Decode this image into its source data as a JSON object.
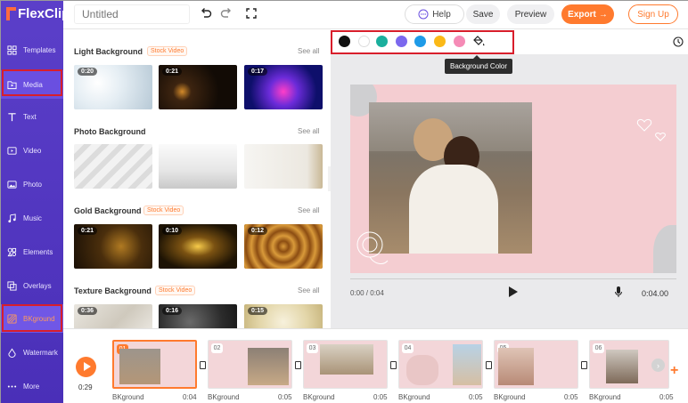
{
  "app": {
    "logo": "FlexClip"
  },
  "sidebar": {
    "items": [
      {
        "label": "Templates",
        "icon": "grid-icon"
      },
      {
        "label": "Media",
        "icon": "folder-play-icon"
      },
      {
        "label": "Text",
        "icon": "text-icon"
      },
      {
        "label": "Video",
        "icon": "video-icon"
      },
      {
        "label": "Photo",
        "icon": "image-icon"
      },
      {
        "label": "Music",
        "icon": "music-icon"
      },
      {
        "label": "Elements",
        "icon": "shapes-icon"
      },
      {
        "label": "Overlays",
        "icon": "layers-icon"
      },
      {
        "label": "BKground",
        "icon": "background-icon"
      },
      {
        "label": "Watermark",
        "icon": "watermark-icon"
      },
      {
        "label": "More",
        "icon": "more-icon"
      }
    ]
  },
  "topbar": {
    "title_placeholder": "Untitled",
    "help_label": "Help",
    "save_label": "Save",
    "preview_label": "Preview",
    "export_label": "Export",
    "signup_label": "Sign Up"
  },
  "panel": {
    "sections": [
      {
        "title": "Light Background",
        "badge": "Stock Video",
        "see_all": "See all",
        "durations": [
          "0:20",
          "0:21",
          "0:17"
        ]
      },
      {
        "title": "Photo Background",
        "badge": "",
        "see_all": "See all",
        "durations": [
          "",
          "",
          ""
        ]
      },
      {
        "title": "Gold Background",
        "badge": "Stock Video",
        "see_all": "See all",
        "durations": [
          "0:21",
          "0:10",
          "0:12"
        ]
      },
      {
        "title": "Texture Background",
        "badge": "Stock Video",
        "see_all": "See all",
        "durations": [
          "0:36",
          "0:16",
          "0:15"
        ]
      }
    ]
  },
  "colors": {
    "swatches": [
      "#111111",
      "#ffffff",
      "#1aaf9d",
      "#7b68ee",
      "#1e9be8",
      "#fbb917",
      "#f58bb6"
    ],
    "tooltip": "Background Color"
  },
  "player": {
    "current": "0:00 / 0:04",
    "total": "0:04.00"
  },
  "timeline": {
    "time": "0:29",
    "clips": [
      {
        "num": "01",
        "label": "BKground",
        "dur": "0:04"
      },
      {
        "num": "02",
        "label": "BKground",
        "dur": "0:05"
      },
      {
        "num": "03",
        "label": "BKground",
        "dur": "0:05"
      },
      {
        "num": "04",
        "label": "BKground",
        "dur": "0:05"
      },
      {
        "num": "05",
        "label": "BKground",
        "dur": "0:05"
      },
      {
        "num": "06",
        "label": "BKground",
        "dur": "0:05"
      }
    ]
  }
}
